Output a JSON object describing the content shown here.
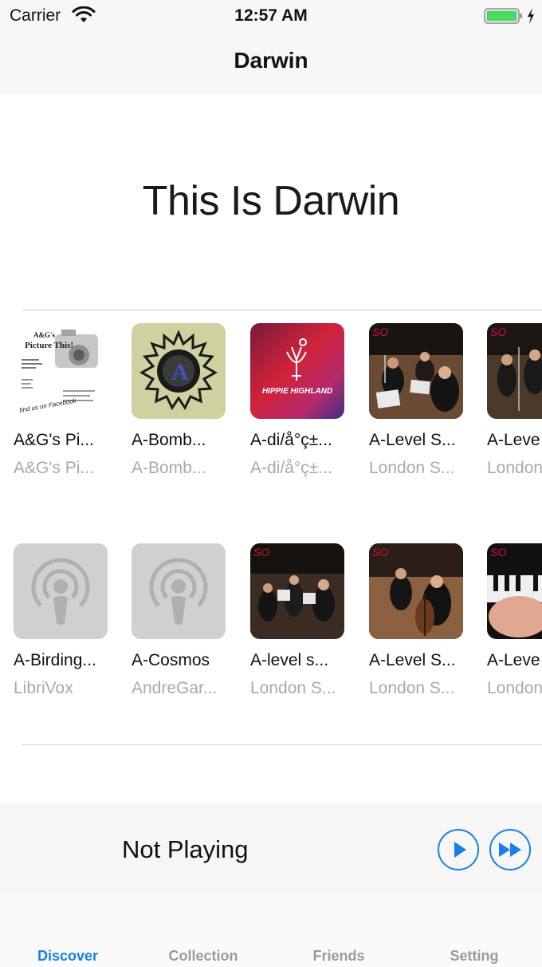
{
  "status_bar": {
    "carrier": "Carrier",
    "time": "12:57 AM",
    "battery_color": "#4cd964"
  },
  "nav": {
    "title": "Darwin"
  },
  "hero": {
    "title": "This Is Darwin"
  },
  "grid": {
    "row1": [
      {
        "title": "A&G's Pi...",
        "subtitle": "A&G's Pi...",
        "art": "picture-this-flyer"
      },
      {
        "title": "A-Bomb...",
        "subtitle": "A-Bomb...",
        "art": "bomb-sun-emblem"
      },
      {
        "title": "A-di/å°ç±...",
        "subtitle": "A-di/å°ç±...",
        "art": "hippie-highland"
      },
      {
        "title": "A-Level S...",
        "subtitle": "London S...",
        "art": "orchestra-photo"
      },
      {
        "title": "A-Leve",
        "subtitle": "London",
        "art": "orchestra-photo"
      }
    ],
    "row2": [
      {
        "title": "A-Birding...",
        "subtitle": "LibriVox",
        "art": "podcast-placeholder"
      },
      {
        "title": "A-Cosmos",
        "subtitle": "AndreGar...",
        "art": "podcast-placeholder"
      },
      {
        "title": "A-level s...",
        "subtitle": "London S...",
        "art": "orchestra-photo"
      },
      {
        "title": "A-Level S...",
        "subtitle": "London S...",
        "art": "cello-photo"
      },
      {
        "title": "A-Leve",
        "subtitle": "London",
        "art": "piano-photo"
      }
    ],
    "hippie_text": "HIPPIE HIGHLAND",
    "flyer_text": "A&G's Picture This!",
    "logo_text": "SO"
  },
  "player": {
    "status": "Not Playing",
    "accent": "#1a7fe8"
  },
  "tabs": [
    {
      "label": "Discover",
      "active": true
    },
    {
      "label": "Collection",
      "active": false
    },
    {
      "label": "Friends",
      "active": false
    },
    {
      "label": "Setting",
      "active": false
    }
  ]
}
